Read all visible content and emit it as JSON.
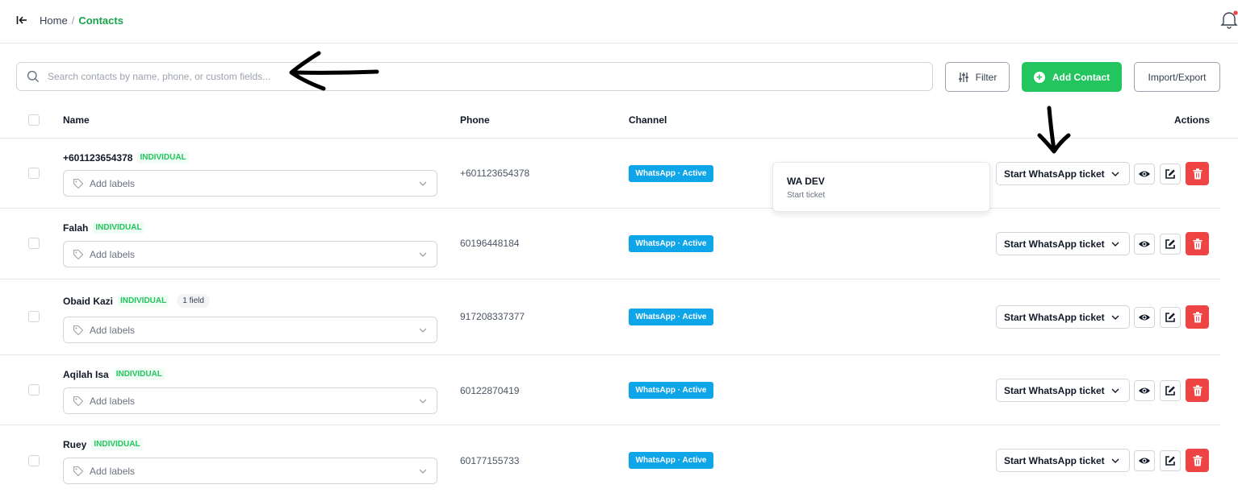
{
  "header": {
    "breadcrumb_home": "Home",
    "breadcrumb_sep": "/",
    "breadcrumb_current": "Contacts",
    "accent_color": "#16a34a",
    "notification_dot_color": "#ef4444"
  },
  "toolbar": {
    "search_placeholder": "Search contacts by name, phone, or custom fields...",
    "search_value": "",
    "filter_label": "Filter",
    "add_label": "Add Contact",
    "import_label": "Import/Export",
    "add_color": "#22c55e"
  },
  "table": {
    "headers": {
      "name": "Name",
      "phone": "Phone",
      "channel": "Channel",
      "actions": "Actions"
    },
    "rows": [
      {
        "name": "+601123654378",
        "type": "INDIVIDUAL",
        "extra": "",
        "labels_placeholder": "Add labels",
        "phone": "+601123654378",
        "channel": "WhatsApp · Active",
        "ticket": "Start WhatsApp ticket"
      },
      {
        "name": "Falah",
        "type": "INDIVIDUAL",
        "extra": "",
        "labels_placeholder": "Add labels",
        "phone": "60196448184",
        "channel": "WhatsApp · Active",
        "ticket": "Start WhatsApp ticket"
      },
      {
        "name": "Obaid Kazi",
        "type": "INDIVIDUAL",
        "extra": "1 field",
        "labels_placeholder": "Add labels",
        "phone": "917208337377",
        "channel": "WhatsApp · Active",
        "ticket": "Start WhatsApp ticket"
      },
      {
        "name": "Aqilah Isa",
        "type": "INDIVIDUAL",
        "extra": "",
        "labels_placeholder": "Add labels",
        "phone": "60122870419",
        "channel": "WhatsApp · Active",
        "ticket": "Start WhatsApp ticket"
      },
      {
        "name": "Ruey",
        "type": "INDIVIDUAL",
        "extra": "",
        "labels_placeholder": "Add labels",
        "phone": "60177155733",
        "channel": "WhatsApp · Active",
        "ticket": "Start WhatsApp ticket"
      }
    ]
  },
  "dropdown": {
    "title": "WA DEV",
    "subtitle": "Start ticket"
  },
  "colors": {
    "channel_badge": "#0ea5e9",
    "delete_button": "#ef4444",
    "type_badge_text": "#22c55e"
  },
  "icons": [
    "collapse-icon",
    "bell-icon",
    "search-icon",
    "filter-icon",
    "plus-circle-icon",
    "tag-icon",
    "chevron-down-icon",
    "eye-icon",
    "edit-icon",
    "trash-icon",
    "arrow-left-annotation",
    "arrow-down-annotation"
  ]
}
